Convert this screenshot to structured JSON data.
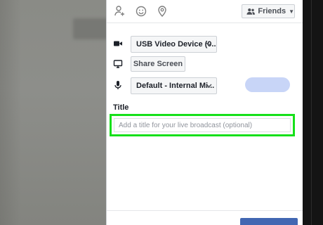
{
  "topbar": {
    "icons": [
      "tag-person-icon",
      "smiley-icon",
      "location-pin-icon"
    ],
    "audience_label": "Friends",
    "audience_icon": "people-icon"
  },
  "sources": {
    "video": {
      "icon": "video-camera-icon",
      "value": "USB Video Device (0..."
    },
    "screen": {
      "icon": "monitor-icon",
      "button_label": "Share Screen"
    },
    "audio": {
      "icon": "microphone-icon",
      "value": "Default - Internal Mi..."
    }
  },
  "title": {
    "label": "Title",
    "placeholder": "Add a title for your live broadcast (optional)",
    "value": ""
  },
  "colors": {
    "highlight": "#16e01a",
    "accent_pill": "#c8d5f7",
    "primary_button": "#4267b2"
  }
}
